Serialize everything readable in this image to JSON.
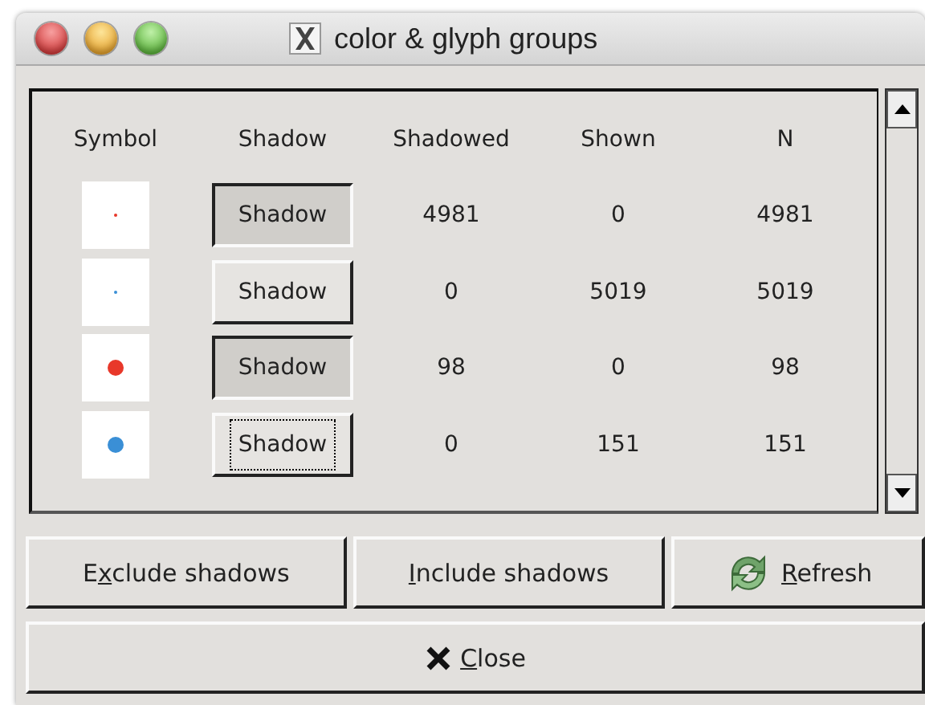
{
  "window": {
    "title": "color & glyph groups"
  },
  "table": {
    "columns": [
      "Symbol",
      "Shadow",
      "Shadowed",
      "Shown",
      "N"
    ],
    "rows": [
      {
        "symbol": {
          "color": "#e8382a",
          "kind": "tiny"
        },
        "button": "Shadow",
        "pressed": true,
        "focused": false,
        "shadowed": "4981",
        "shown": "0",
        "n": "4981"
      },
      {
        "symbol": {
          "color": "#3a8fd6",
          "kind": "tiny"
        },
        "button": "Shadow",
        "pressed": false,
        "focused": false,
        "shadowed": "0",
        "shown": "5019",
        "n": "5019"
      },
      {
        "symbol": {
          "color": "#e8382a",
          "kind": "large"
        },
        "button": "Shadow",
        "pressed": true,
        "focused": false,
        "shadowed": "98",
        "shown": "0",
        "n": "98"
      },
      {
        "symbol": {
          "color": "#3a8fd6",
          "kind": "large"
        },
        "button": "Shadow",
        "pressed": false,
        "focused": true,
        "shadowed": "0",
        "shown": "151",
        "n": "151"
      }
    ]
  },
  "actions": [
    {
      "kind": "exclude",
      "label": {
        "before": "E",
        "key": "x",
        "after": "clude shadows"
      }
    },
    {
      "kind": "include",
      "label": {
        "key": "I",
        "after": "nclude shadows"
      }
    },
    {
      "kind": "refresh",
      "label": {
        "key": "R",
        "after": "efresh"
      }
    }
  ],
  "close": {
    "label": {
      "key": "C",
      "after": "lose"
    }
  }
}
